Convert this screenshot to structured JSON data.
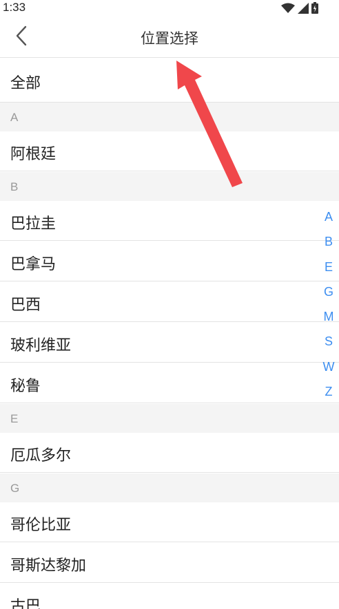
{
  "status_bar": {
    "time": "1:33"
  },
  "nav": {
    "title": "位置选择",
    "back_icon": "chevron-left-icon"
  },
  "all_item": {
    "label": "全部"
  },
  "sections": [
    {
      "letter": "A",
      "items": [
        "阿根廷"
      ]
    },
    {
      "letter": "B",
      "items": [
        "巴拉圭",
        "巴拿马",
        "巴西",
        "玻利维亚",
        "秘鲁"
      ]
    },
    {
      "letter": "E",
      "items": [
        "厄瓜多尔"
      ]
    },
    {
      "letter": "G",
      "items": [
        "哥伦比亚",
        "哥斯达黎加",
        "古巴"
      ]
    }
  ],
  "index_bar": [
    "A",
    "B",
    "E",
    "G",
    "M",
    "S",
    "W",
    "Z"
  ],
  "colors": {
    "accent": "#3d8ef0",
    "annotation_arrow": "#f0474b",
    "section_bg": "#f4f4f4",
    "divider": "#e3e3e3"
  }
}
